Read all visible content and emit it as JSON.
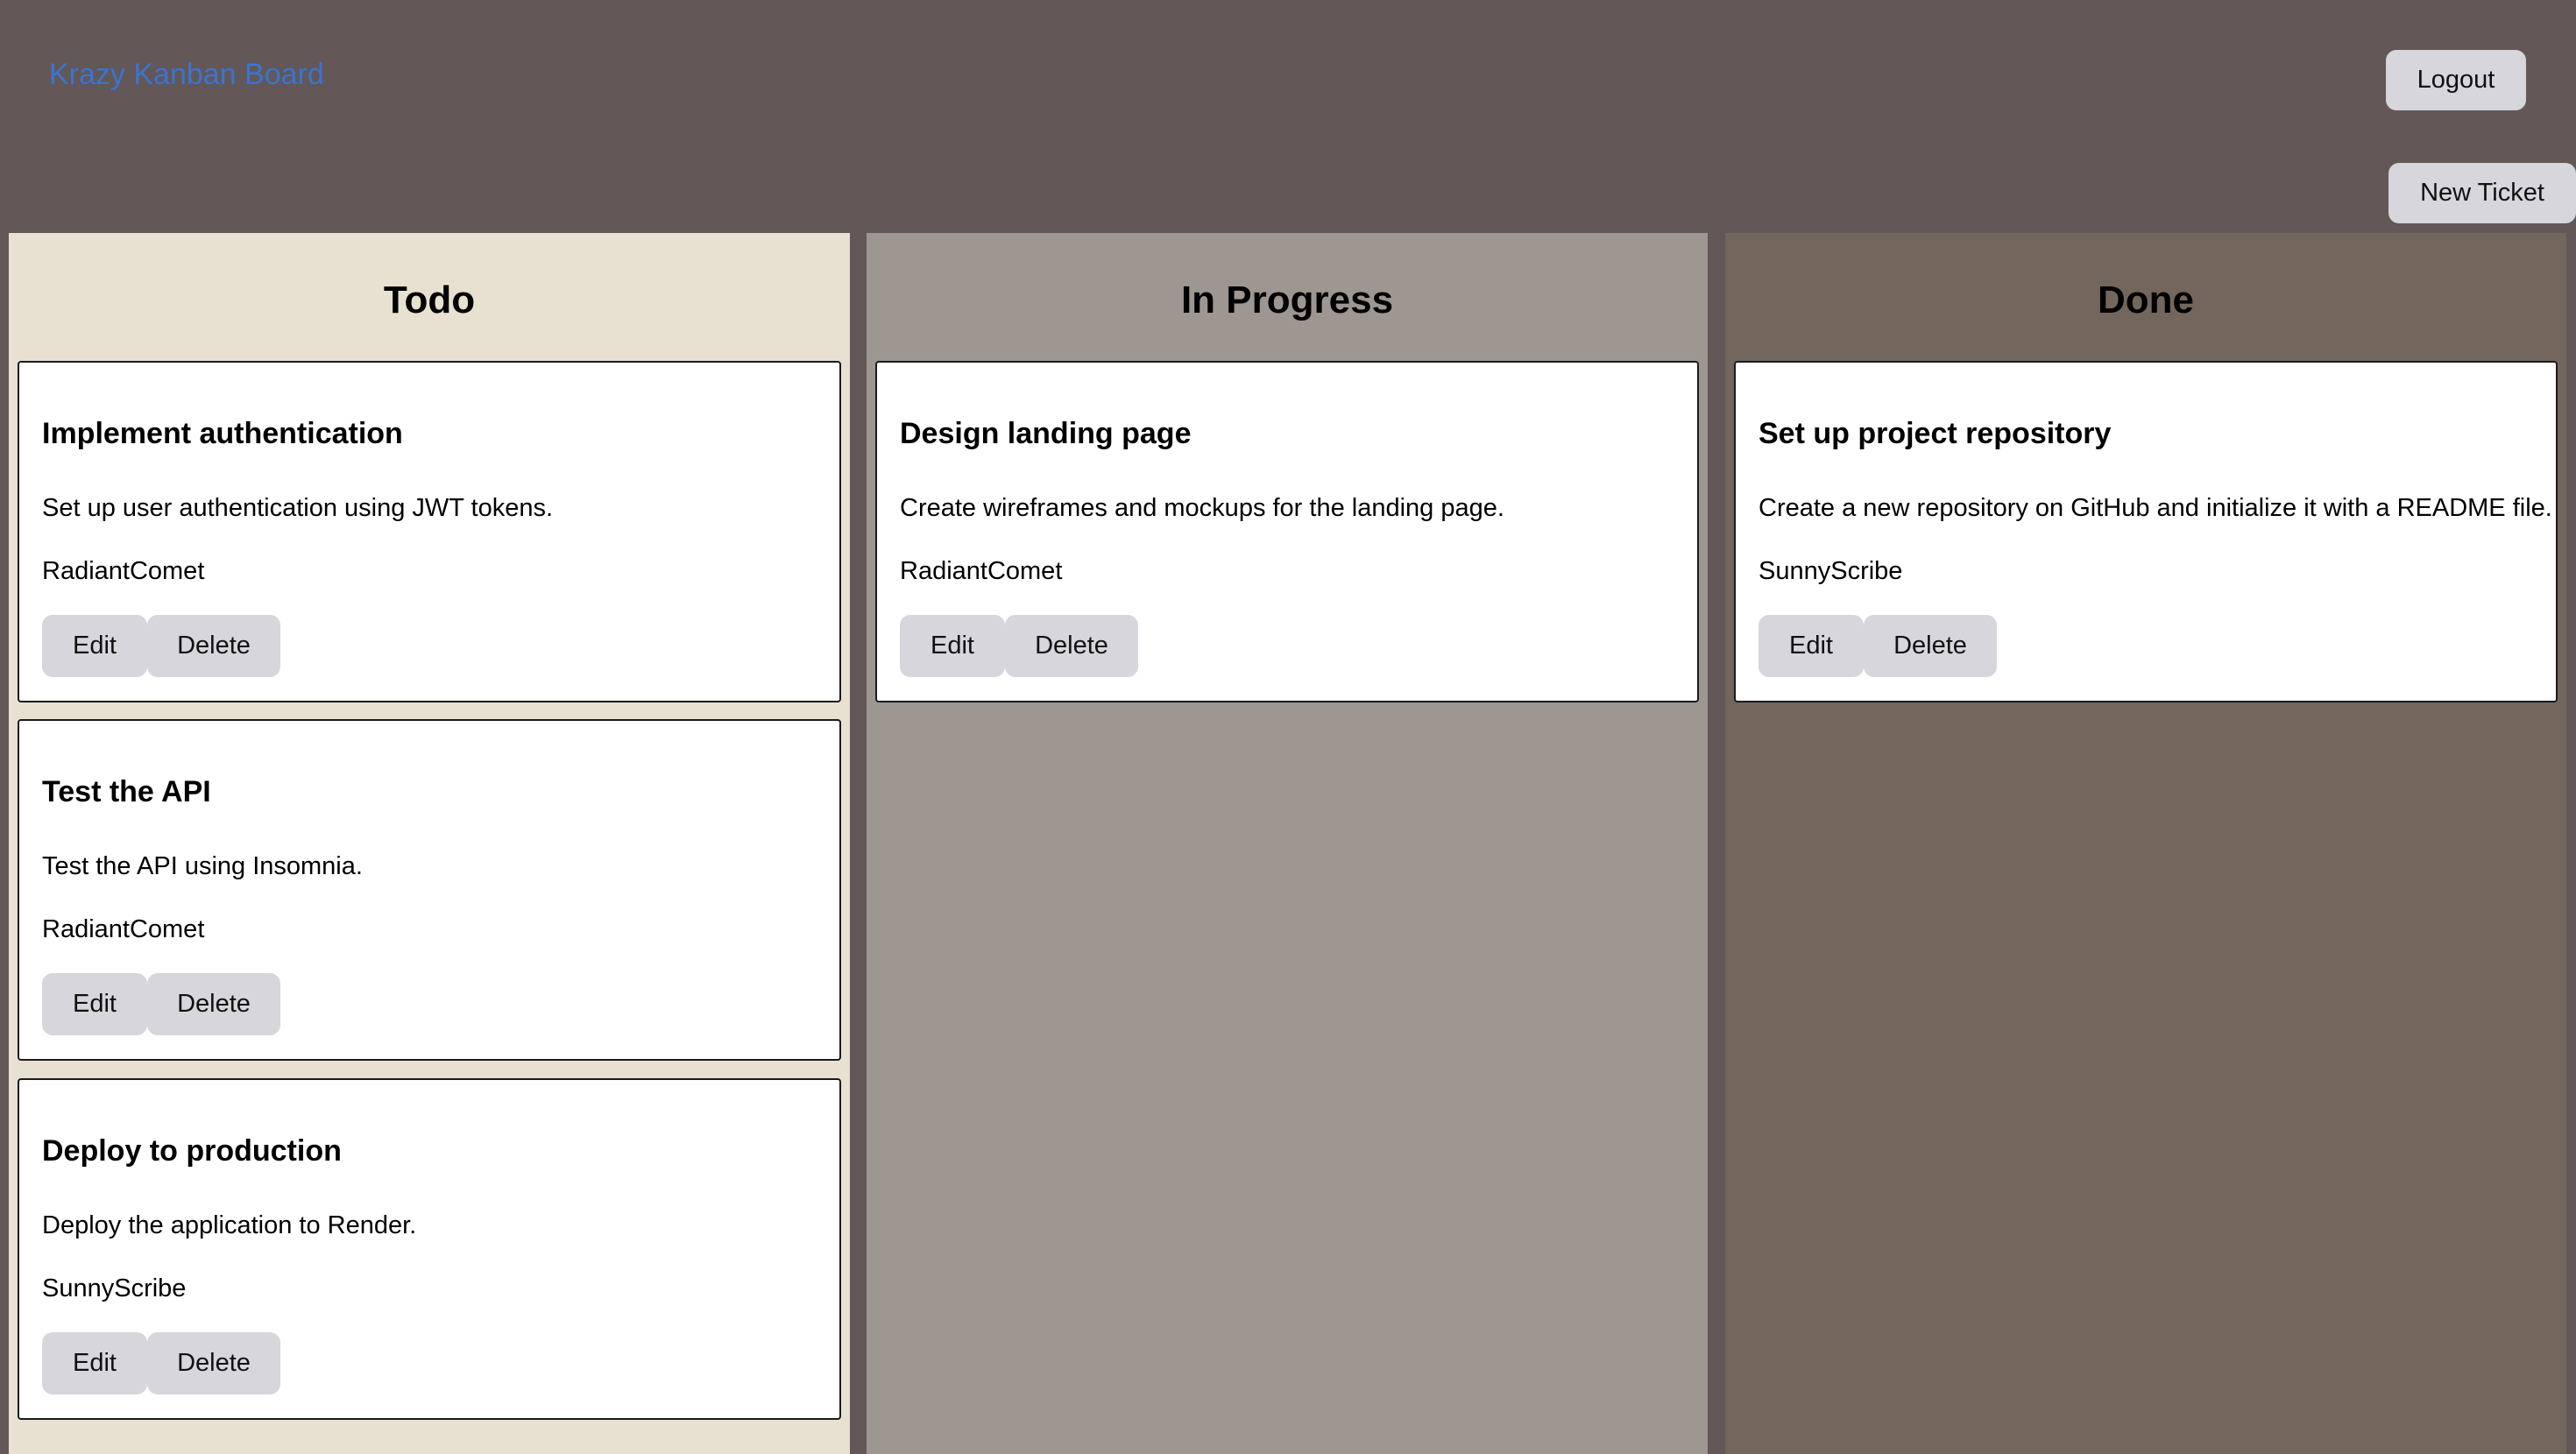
{
  "header": {
    "brand": "Krazy Kanban Board",
    "logout_label": "Logout",
    "new_ticket_label": "New Ticket"
  },
  "columns": [
    {
      "title": "Todo",
      "color": "#e8e0d1",
      "cards": [
        {
          "title": "Implement authentication",
          "description": "Set up user authentication using JWT tokens.",
          "assignee": "RadiantComet",
          "edit": "Edit",
          "delete": "Delete"
        },
        {
          "title": "Test the API",
          "description": "Test the API using Insomnia.",
          "assignee": "RadiantComet",
          "edit": "Edit",
          "delete": "Delete"
        },
        {
          "title": "Deploy to production",
          "description": "Deploy the application to Render.",
          "assignee": "SunnyScribe",
          "edit": "Edit",
          "delete": "Delete"
        }
      ]
    },
    {
      "title": "In Progress",
      "color": "#9e9691",
      "cards": [
        {
          "title": "Design landing page",
          "description": "Create wireframes and mockups for the landing page.",
          "assignee": "RadiantComet",
          "edit": "Edit",
          "delete": "Delete"
        }
      ]
    },
    {
      "title": "Done",
      "color": "#73665c",
      "cards": [
        {
          "title": "Set up project repository",
          "description": "Create a new repository on GitHub and initialize it with a README file.",
          "assignee": "SunnyScribe",
          "edit": "Edit",
          "delete": "Delete"
        }
      ]
    }
  ],
  "colors": {
    "background": "#635757",
    "brand_link": "#3a74d0",
    "button": "#d6d6dc"
  }
}
